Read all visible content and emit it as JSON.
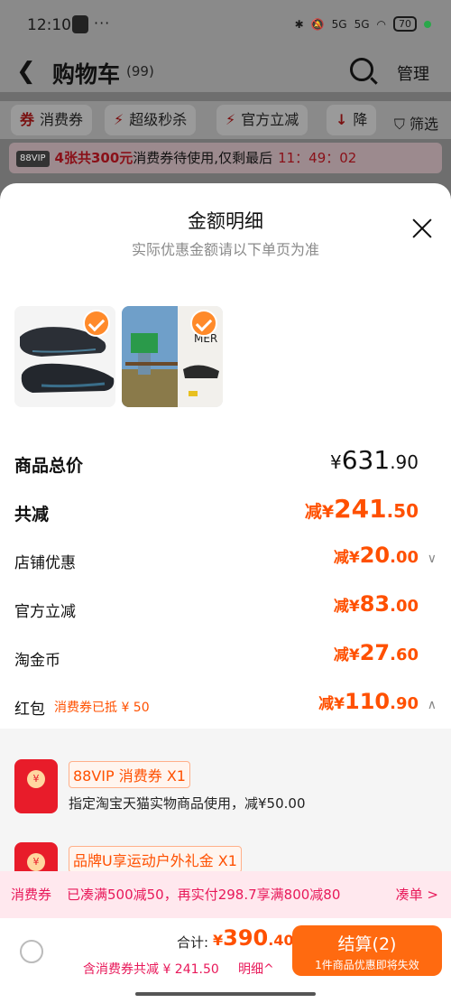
{
  "status": {
    "time": "12:10",
    "battery": "70",
    "net1": "5G",
    "net2": "5G"
  },
  "header": {
    "title": "购物车",
    "count": "(99)",
    "manage": "管理"
  },
  "chips": [
    {
      "icon": "券",
      "label": "消费券"
    },
    {
      "icon": "⚡",
      "label": "超级秒杀"
    },
    {
      "icon": "⚡",
      "label": "官方立减"
    },
    {
      "icon": "↓",
      "label": "降"
    }
  ],
  "filter_label": "筛选",
  "vip_bar": {
    "tag": "88VIP",
    "hot": "4张共300元",
    "text": "消费券待使用,仅剩最后",
    "time": "11：49：02"
  },
  "sheet": {
    "title": "金额明细",
    "subtitle": "实际优惠金额请以下单页为准",
    "total": {
      "label": "商品总价",
      "prefix": "¥",
      "int": "631",
      "dec": ".90"
    },
    "reduce": {
      "label": "共减",
      "prefix": "减¥",
      "int": "241",
      "dec": ".50"
    },
    "items": [
      {
        "label": "店铺优惠",
        "prefix": "减¥",
        "int": "20",
        "dec": ".00"
      },
      {
        "label": "官方立减",
        "prefix": "减¥",
        "int": "83",
        "dec": ".00"
      },
      {
        "label": "淘金币",
        "prefix": "减¥",
        "int": "27",
        "dec": ".60"
      },
      {
        "label": "红包",
        "prefix": "减¥",
        "int": "110",
        "dec": ".90",
        "tag": "消费券已抵 ¥ 50"
      }
    ],
    "coupons": [
      {
        "tag": "88VIP 消费券 X1",
        "desc": "指定淘宝天猫实物商品使用，减¥50.00"
      },
      {
        "tag": "品牌U享运动户外礼金 X1",
        "desc": ""
      }
    ]
  },
  "promo": {
    "label": "消费券",
    "text": "已凑满500减50，再实付298.7享满800减80",
    "action": "凑单 >"
  },
  "checkout": {
    "sum_label": "合计:",
    "sum_prefix": "¥",
    "sum_int": "390",
    "sum_dec": ".40",
    "note": "含消费券共减 ¥ 241.50",
    "detail": "明细^",
    "pay_label": "结算(2)",
    "pay_sub": "1件商品优惠即将失效"
  }
}
